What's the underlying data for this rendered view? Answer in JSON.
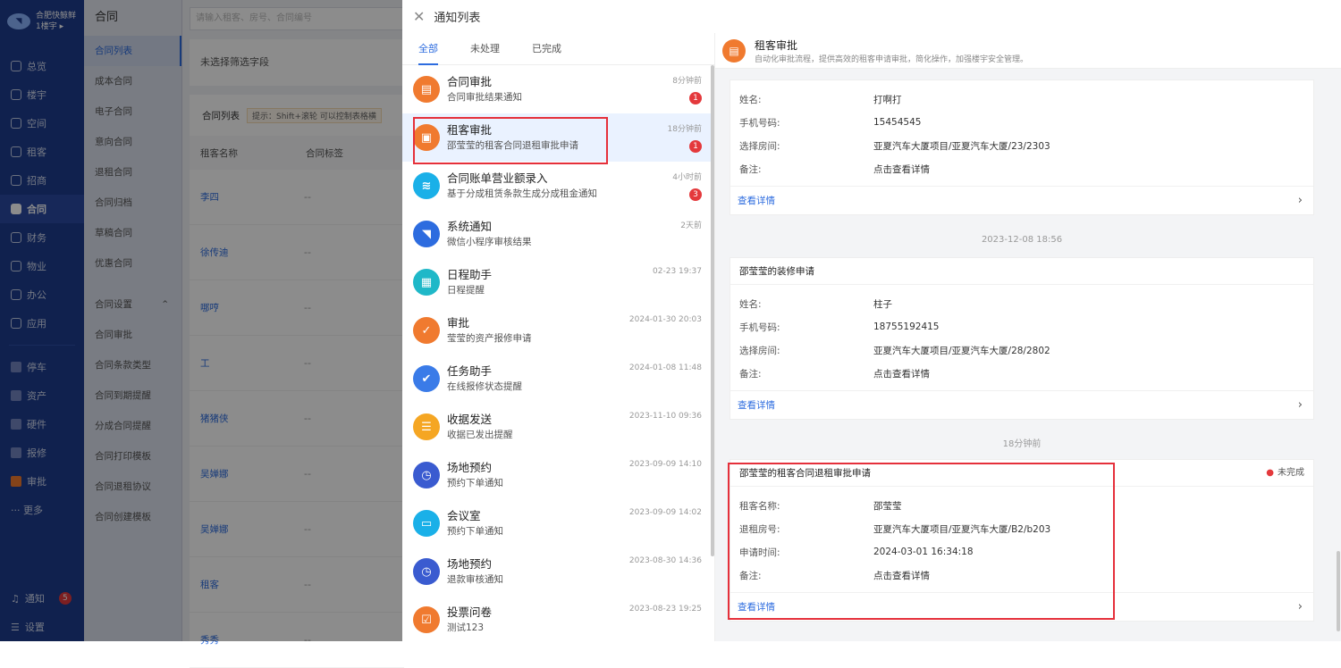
{
  "sidebar": {
    "brand_name": "合肥快鲸鲜",
    "brand_sub": "1楼宇 ▸",
    "nav": [
      "总览",
      "楼宇",
      "空间",
      "租客",
      "招商",
      "合同",
      "财务",
      "物业",
      "办公",
      "应用"
    ],
    "nav2": [
      "停车",
      "资产",
      "硬件",
      "报修",
      "审批"
    ],
    "more": "··· 更多",
    "notify": "通知",
    "notify_count": "5",
    "settings": "设置"
  },
  "subnav": {
    "title": "合同",
    "items": [
      "合同列表",
      "成本合同",
      "电子合同",
      "意向合同",
      "退租合同",
      "合同归档",
      "草稿合同",
      "优惠合同"
    ],
    "group_label": "合同设置",
    "group_items": [
      "合同审批",
      "合同条款类型",
      "合同到期提醒",
      "分成合同提醒",
      "合同打印模板",
      "合同退租协议",
      "合同创建模板"
    ]
  },
  "main": {
    "search_placeholder": "请输入租客、房号、合同编号",
    "filter_text": "未选择筛选字段",
    "table_title": "合同列表",
    "hint": "提示：Shift+滚轮 可以控制表格横",
    "col1": "租客名称",
    "col2": "合同标签",
    "rows": [
      {
        "name": "李四",
        "tag": "--"
      },
      {
        "name": "徐传迪",
        "tag": "--"
      },
      {
        "name": "哪哼",
        "tag": "--"
      },
      {
        "name": "工",
        "tag": "--"
      },
      {
        "name": "猪猪侠",
        "tag": "--"
      },
      {
        "name": "吴婵娜",
        "tag": "--"
      },
      {
        "name": "吴婵娜",
        "tag": "--"
      },
      {
        "name": "租客",
        "tag": "--"
      },
      {
        "name": "秀秀",
        "tag": "--"
      }
    ]
  },
  "drawer": {
    "title": "通知列表",
    "tabs": [
      "全部",
      "未处理",
      "已完成"
    ],
    "items": [
      {
        "title": "合同审批",
        "desc": "合同审批结果通知",
        "time": "8分钟前",
        "count": "1",
        "color": "#f07a2f",
        "icon": "document-icon"
      },
      {
        "title": "租客审批",
        "desc": "邵莹莹的租客合同退租审批申请",
        "time": "18分钟前",
        "count": "1",
        "color": "#f07a2f",
        "icon": "tenant-doc-icon"
      },
      {
        "title": "合同账单营业额录入",
        "desc": "基于分成租赁条款生成分成租金通知",
        "time": "4小时前",
        "count": "3",
        "color": "#1ab0e8",
        "icon": "layers-icon"
      },
      {
        "title": "系统通知",
        "desc": "微信小程序审核结果",
        "time": "2天前",
        "count": "",
        "color": "#2d6cdf",
        "icon": "whale-icon"
      },
      {
        "title": "日程助手",
        "desc": "日程提醒",
        "time": "02-23 19:37",
        "count": "",
        "color": "#1fb8c8",
        "icon": "calendar-icon"
      },
      {
        "title": "审批",
        "desc": "莹莹的资产报修申请",
        "time": "2024-01-30 20:03",
        "count": "",
        "color": "#f07a2f",
        "icon": "approval-icon"
      },
      {
        "title": "任务助手",
        "desc": "在线报修状态提醒",
        "time": "2024-01-08 11:48",
        "count": "",
        "color": "#3a7be8",
        "icon": "check-icon"
      },
      {
        "title": "收据发送",
        "desc": "收据已发出提醒",
        "time": "2023-11-10 09:36",
        "count": "",
        "color": "#f5a623",
        "icon": "receipt-icon"
      },
      {
        "title": "场地预约",
        "desc": "预约下单通知",
        "time": "2023-09-09 14:10",
        "count": "",
        "color": "#3a5bd0",
        "icon": "calendar-clock-icon"
      },
      {
        "title": "会议室",
        "desc": "预约下单通知",
        "time": "2023-09-09 14:02",
        "count": "",
        "color": "#1ab0e8",
        "icon": "meeting-icon"
      },
      {
        "title": "场地预约",
        "desc": "退款审核通知",
        "time": "2023-08-30 14:36",
        "count": "",
        "color": "#3a5bd0",
        "icon": "calendar-clock-icon"
      },
      {
        "title": "投票问卷",
        "desc": "测试123",
        "time": "2023-08-23 19:25",
        "count": "",
        "color": "#f07a2f",
        "icon": "vote-icon"
      }
    ]
  },
  "detail": {
    "title": "租客审批",
    "subtitle": "自动化审批流程，提供高效的租客申请审批，简化操作，加强楼宇安全管理。",
    "cards": [
      {
        "title": "",
        "status": "",
        "rows": [
          [
            "姓名:",
            "打啊打"
          ],
          [
            "手机号码:",
            "15454545"
          ],
          [
            "选择房间:",
            "亚夏汽车大厦项目/亚夏汽车大厦/23/2303"
          ],
          [
            "备注:",
            "点击查看详情"
          ]
        ],
        "link": "查看详情"
      },
      {
        "title": "邵莹莹的装修申请",
        "status": "",
        "rows": [
          [
            "姓名:",
            "柱子"
          ],
          [
            "手机号码:",
            "18755192415"
          ],
          [
            "选择房间:",
            "亚夏汽车大厦项目/亚夏汽车大厦/28/2802"
          ],
          [
            "备注:",
            "点击查看详情"
          ]
        ],
        "link": "查看详情"
      },
      {
        "title": "邵莹莹的租客合同退租审批申请",
        "status": "未完成",
        "rows": [
          [
            "租客名称:",
            "邵莹莹"
          ],
          [
            "退租房号:",
            "亚夏汽车大厦项目/亚夏汽车大厦/B2/b203"
          ],
          [
            "申请时间:",
            "2024-03-01 16:34:18"
          ],
          [
            "备注:",
            "点击查看详情"
          ]
        ],
        "link": "查看详情"
      }
    ],
    "ts1": "2023-12-08 18:56",
    "ts2": "18分钟前"
  }
}
